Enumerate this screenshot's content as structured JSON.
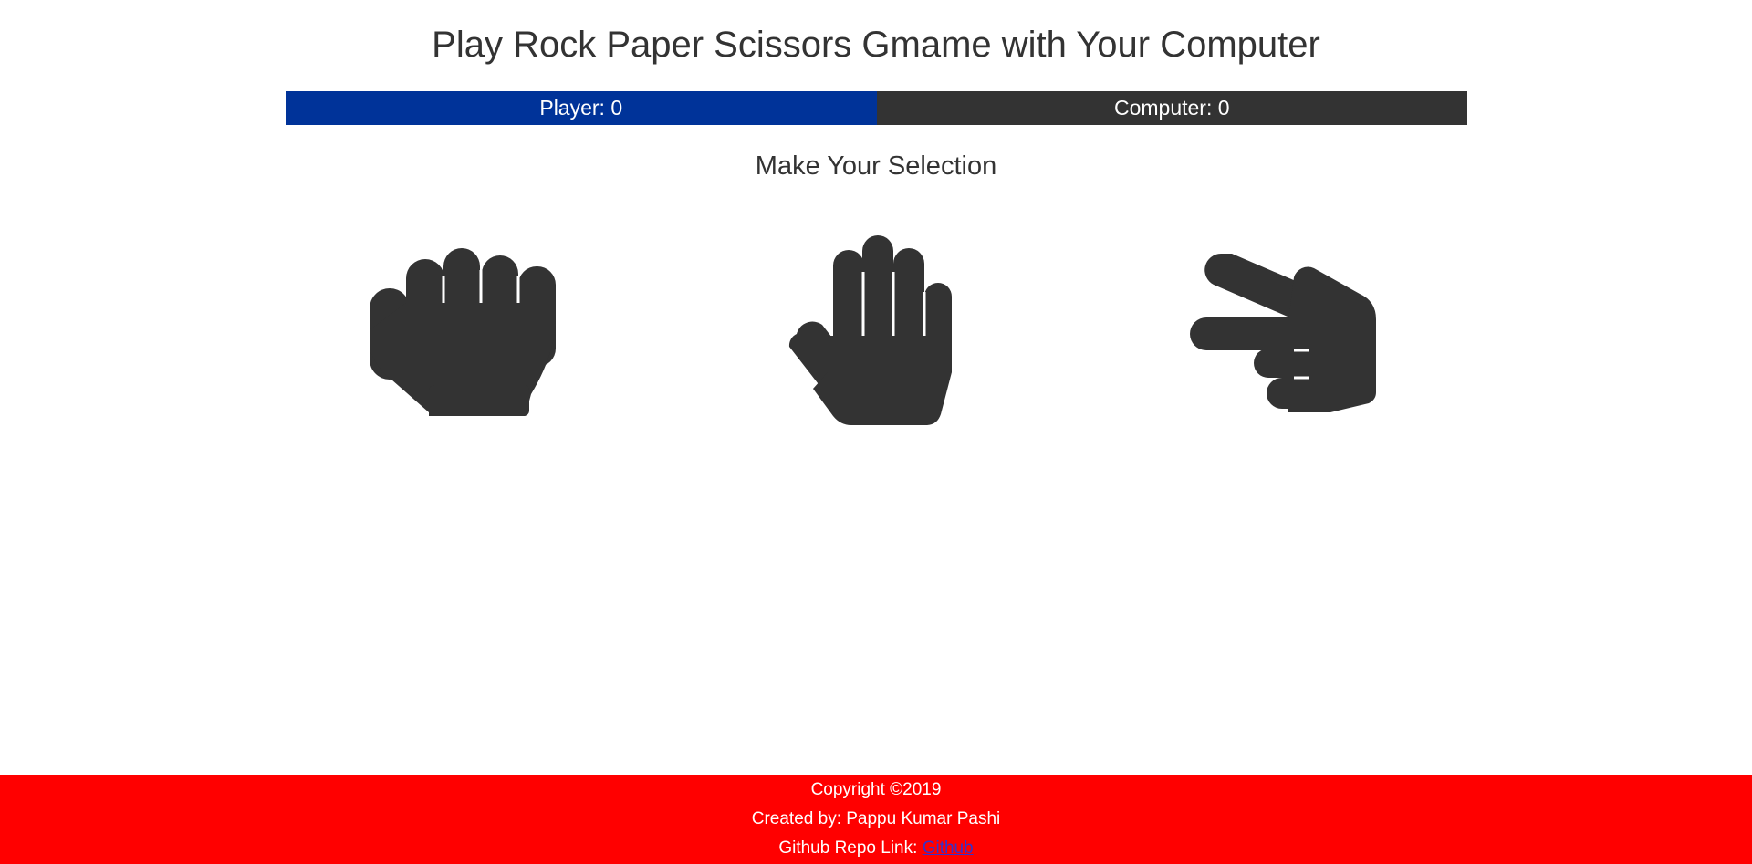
{
  "header": {
    "title": "Play Rock Paper Scissors Gmame with Your Computer"
  },
  "scoreboard": {
    "player_label": "Player: 0",
    "computer_label": "Computer: 0",
    "player_color": "#003399",
    "computer_color": "#333333"
  },
  "main": {
    "prompt": "Make Your Selection",
    "choices": [
      {
        "id": "rock",
        "icon": "hand-rock-icon"
      },
      {
        "id": "paper",
        "icon": "hand-paper-icon"
      },
      {
        "id": "scissors",
        "icon": "hand-scissors-icon"
      }
    ]
  },
  "footer": {
    "copyright": "Copyright ©2019",
    "created_by": "Created by: Pappu Kumar Pashi",
    "repo_prefix": "Github Repo Link: ",
    "repo_link_label": "Github",
    "background": "#ff0000"
  }
}
